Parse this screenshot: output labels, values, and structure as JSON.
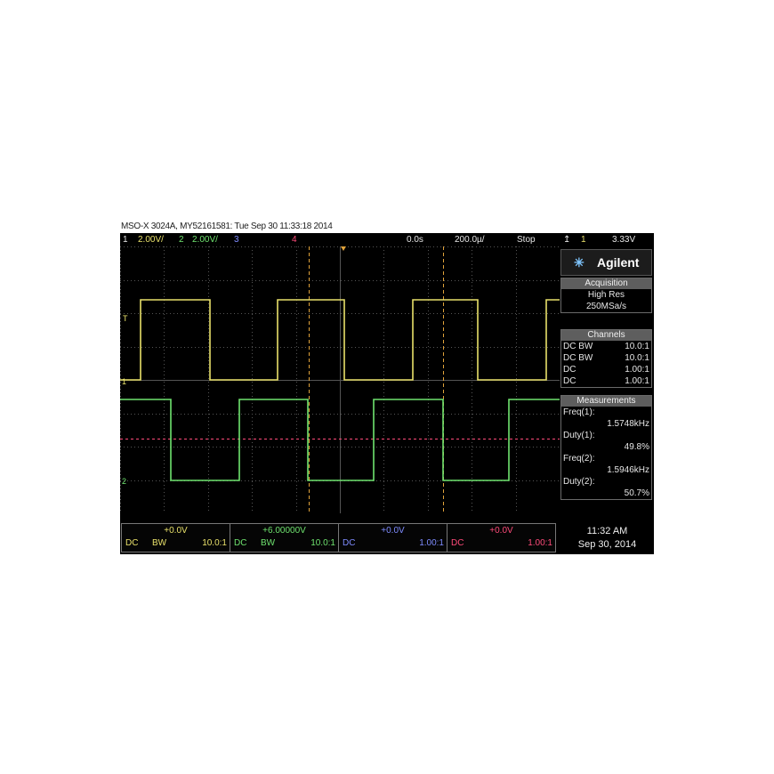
{
  "caption": "MSO-X 3024A, MY52161581: Tue Sep 30 11:33:18 2014",
  "status_bar": {
    "ch1_num": "1",
    "ch1_scale": "2.00V/",
    "ch2_num": "2",
    "ch2_scale": "2.00V/",
    "ch3_num": "3",
    "ch4_num": "4",
    "time_delay": "0.0s",
    "time_scale": "200.0µ/",
    "run_state": "Stop",
    "trigger_icon": "trigger-rising-edge-icon",
    "trigger_source": "1",
    "trigger_level": "3.33V"
  },
  "brand": {
    "logo_icon": "agilent-spark-icon",
    "name": "Agilent"
  },
  "acquisition": {
    "header": "Acquisition",
    "mode": "High Res",
    "rate": "250MSa/s"
  },
  "channels": {
    "header": "Channels",
    "rows": [
      {
        "coupling": "DC BW",
        "probe": "10.0:1",
        "color": "#e8e06a"
      },
      {
        "coupling": "DC BW",
        "probe": "10.0:1",
        "color": "#6fe36f"
      },
      {
        "coupling": "DC",
        "probe": "1.00:1",
        "color": "#7f8cff"
      },
      {
        "coupling": "DC",
        "probe": "1.00:1",
        "color": "#ff4b7a"
      }
    ]
  },
  "measurements": {
    "header": "Measurements",
    "items": [
      {
        "label": "Freq(1):",
        "value": "1.5748kHz"
      },
      {
        "label": "Duty(1):",
        "value": "49.8%"
      },
      {
        "label": "Freq(2):",
        "value": "1.5946kHz"
      },
      {
        "label": "Duty(2):",
        "value": "50.7%"
      }
    ]
  },
  "channel_boxes": [
    {
      "offset": "+0.0V",
      "coupling": "DC",
      "bw": "BW",
      "probe": "10.0:1",
      "color": "#e8e06a"
    },
    {
      "offset": "+6.00000V",
      "coupling": "DC",
      "bw": "BW",
      "probe": "10.0:1",
      "color": "#6fe36f"
    },
    {
      "offset": "+0.0V",
      "coupling": "DC",
      "bw": "",
      "probe": "1.00:1",
      "color": "#7f8cff"
    },
    {
      "offset": "+0.0V",
      "coupling": "DC",
      "bw": "",
      "probe": "1.00:1",
      "color": "#ff4b7a"
    }
  ],
  "datetime": {
    "time": "11:32 AM",
    "date": "Sep 30, 2014"
  },
  "screen_markers": {
    "trigger_marker": "T",
    "ch1_marker": "1",
    "ch2_marker": "2"
  },
  "colors": {
    "ch1": "#e8e06a",
    "ch2": "#6fe36f",
    "ch3": "#7f8cff",
    "ch4": "#ff4b7a",
    "cursor": "#e0a23a",
    "grid": "#555555"
  }
}
